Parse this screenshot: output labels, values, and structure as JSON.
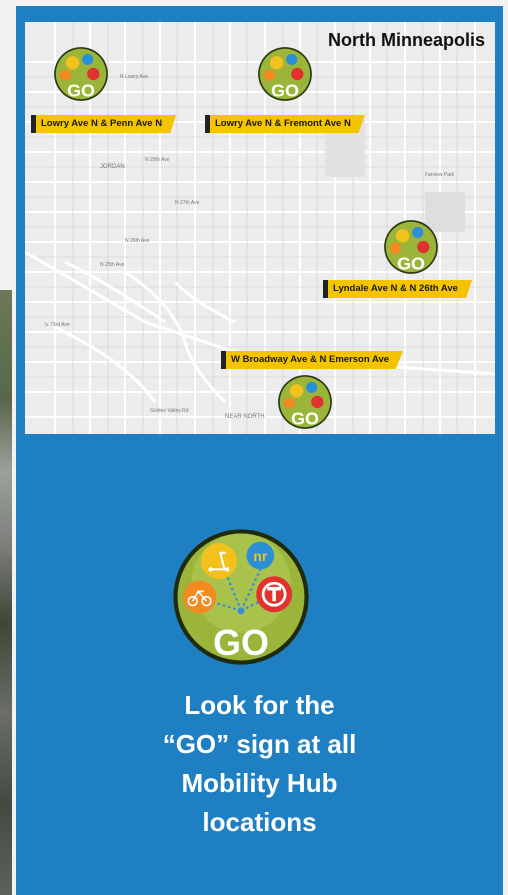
{
  "map": {
    "title": "North Minneapolis",
    "hubs": [
      {
        "label": "Lowry Ave N & Penn Ave N"
      },
      {
        "label": "Lowry Ave N & Fremont Ave N"
      },
      {
        "label": "Lyndale Ave N & N 26th Ave"
      },
      {
        "label": "W Broadway Ave & N Emerson Ave"
      }
    ],
    "streets": [
      "N Lowry Ave",
      "N 27th Ave",
      "N 26th Ave",
      "N 25th Ave",
      "N 23rd Ave",
      "N 29th Ave",
      "Golden Valley Rd",
      "JORDAN",
      "NEAR NORTH",
      "Farview Park"
    ]
  },
  "badge": {
    "text": "GO",
    "icons": [
      "scooter-icon",
      "nice-ride-icon",
      "bike-icon",
      "metro-transit-icon"
    ]
  },
  "tagline": {
    "line1": "Look for the",
    "line2": "“GO” sign at all",
    "line3": "Mobility Hub",
    "line4": "locations"
  },
  "colors": {
    "panel": "#1e7fc3",
    "banner": "#f5c400",
    "badge_green": "#9ab53a",
    "map_bg": "#ececec"
  }
}
